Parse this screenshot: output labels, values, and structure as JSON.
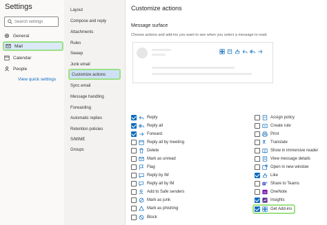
{
  "left": {
    "title": "Settings",
    "search_placeholder": "Search settings",
    "nav": [
      {
        "label": "General",
        "icon": "gear-icon"
      },
      {
        "label": "Mail",
        "icon": "mail-icon"
      },
      {
        "label": "Calendar",
        "icon": "calendar-icon"
      },
      {
        "label": "People",
        "icon": "people-icon"
      }
    ],
    "view_quick": "View quick settings"
  },
  "mid": {
    "items": [
      "Layout",
      "Compose and reply",
      "Attachments",
      "Rules",
      "Sweep",
      "Junk email",
      "Customize actions",
      "Sync email",
      "Message handling",
      "Forwarding",
      "Automatic replies",
      "Retention policies",
      "S/MIME",
      "Groups"
    ]
  },
  "main": {
    "title": "Customize actions",
    "section": "Message surface",
    "description": "Choose actions and add-ins you want to see when you select a message to read.",
    "actions_left": [
      {
        "label": "Reply",
        "checked": true,
        "icon": "reply-icon"
      },
      {
        "label": "Reply all",
        "checked": true,
        "icon": "reply-all-icon"
      },
      {
        "label": "Forward",
        "checked": true,
        "icon": "forward-icon"
      },
      {
        "label": "Reply all by meeting",
        "checked": false,
        "icon": "calendar-reply-icon"
      },
      {
        "label": "Delete",
        "checked": false,
        "icon": "delete-icon"
      },
      {
        "label": "Mark as unread",
        "checked": false,
        "icon": "mark-unread-icon"
      },
      {
        "label": "Flag",
        "checked": false,
        "icon": "flag-icon"
      },
      {
        "label": "Reply by IM",
        "checked": false,
        "icon": "chat-icon"
      },
      {
        "label": "Reply all by IM",
        "checked": false,
        "icon": "chat-all-icon"
      },
      {
        "label": "Add to Safe senders",
        "checked": false,
        "icon": "safe-senders-icon"
      },
      {
        "label": "Mark as junk",
        "checked": false,
        "icon": "junk-icon"
      },
      {
        "label": "Mark as phishing",
        "checked": false,
        "icon": "phishing-icon"
      },
      {
        "label": "Block",
        "checked": false,
        "icon": "block-icon"
      }
    ],
    "actions_right": [
      {
        "label": "Assign policy",
        "checked": false,
        "icon": "policy-icon"
      },
      {
        "label": "Create rule",
        "checked": false,
        "icon": "rule-icon"
      },
      {
        "label": "Print",
        "checked": false,
        "icon": "print-icon"
      },
      {
        "label": "Translate",
        "checked": false,
        "icon": "translate-icon"
      },
      {
        "label": "Show in immersive reader",
        "checked": false,
        "icon": "immersive-reader-icon"
      },
      {
        "label": "View message details",
        "checked": false,
        "icon": "details-icon"
      },
      {
        "label": "Open in new window",
        "checked": false,
        "icon": "new-window-icon"
      },
      {
        "label": "Like",
        "checked": true,
        "icon": "like-icon"
      },
      {
        "label": "Share to Teams",
        "checked": false,
        "icon": "teams-icon"
      },
      {
        "label": "OneNote",
        "checked": false,
        "icon": "onenote-icon"
      },
      {
        "label": "Insights",
        "checked": true,
        "icon": "insights-icon"
      },
      {
        "label": "Get Add-ins",
        "checked": true,
        "icon": "addins-icon"
      }
    ]
  },
  "colors": {
    "accent": "#0f6cbd",
    "highlight": "#9be083"
  }
}
